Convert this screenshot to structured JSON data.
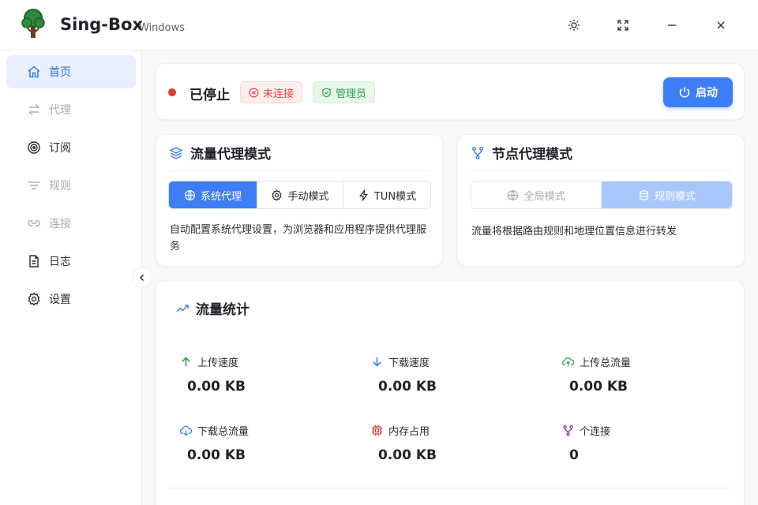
{
  "app": {
    "title": "Sing-Box",
    "subtitle": "Windows"
  },
  "window_controls": [
    "theme-icon",
    "fullscreen-icon",
    "minimize-icon",
    "close-icon"
  ],
  "sidebar": {
    "items": [
      {
        "label": "首页",
        "icon": "home-icon",
        "state": "active"
      },
      {
        "label": "代理",
        "icon": "swap-icon",
        "state": "disabled"
      },
      {
        "label": "订阅",
        "icon": "subscribe-icon",
        "state": "normal"
      },
      {
        "label": "规则",
        "icon": "rules-icon",
        "state": "disabled"
      },
      {
        "label": "连接",
        "icon": "link-icon",
        "state": "disabled"
      },
      {
        "label": "日志",
        "icon": "log-icon",
        "state": "normal"
      },
      {
        "label": "设置",
        "icon": "gear-icon",
        "state": "normal"
      }
    ]
  },
  "status": {
    "text": "已停止",
    "disconnected_badge": "未连接",
    "admin_badge": "管理员",
    "start_button": "启动"
  },
  "traffic_mode": {
    "title": "流量代理模式",
    "options": [
      {
        "label": "系统代理",
        "icon": "globe-icon",
        "selected": true
      },
      {
        "label": "手动模式",
        "icon": "gear-icon",
        "selected": false
      },
      {
        "label": "TUN模式",
        "icon": "bolt-icon",
        "selected": false
      }
    ],
    "description": "自动配置系统代理设置，为浏览器和应用程序提供代理服务"
  },
  "node_mode": {
    "title": "节点代理模式",
    "options": [
      {
        "label": "全局模式",
        "icon": "globe-icon",
        "selected": false
      },
      {
        "label": "规则模式",
        "icon": "layers-icon",
        "selected": true
      }
    ],
    "description": "流量将根据路由规则和地理位置信息进行转发"
  },
  "stats": {
    "title": "流量统计",
    "items": [
      {
        "label": "上传速度",
        "value": "0.00 KB",
        "icon": "arrow-up-icon"
      },
      {
        "label": "下载速度",
        "value": "0.00 KB",
        "icon": "arrow-down-icon"
      },
      {
        "label": "上传总流量",
        "value": "0.00 KB",
        "icon": "cloud-upload-icon"
      },
      {
        "label": "下载总流量",
        "value": "0.00 KB",
        "icon": "cloud-download-icon"
      },
      {
        "label": "内存占用",
        "value": "0.00 KB",
        "icon": "chip-icon"
      },
      {
        "label": "个连接",
        "value": "0",
        "icon": "connections-icon"
      }
    ]
  },
  "colors": {
    "accent": "#3d7ef6",
    "stopped": "#e53935",
    "admin": "#2e9e53",
    "upload": "#2e9e53",
    "download": "#3d7ef6",
    "memory": "#e53935",
    "connections": "#9c27b0"
  }
}
